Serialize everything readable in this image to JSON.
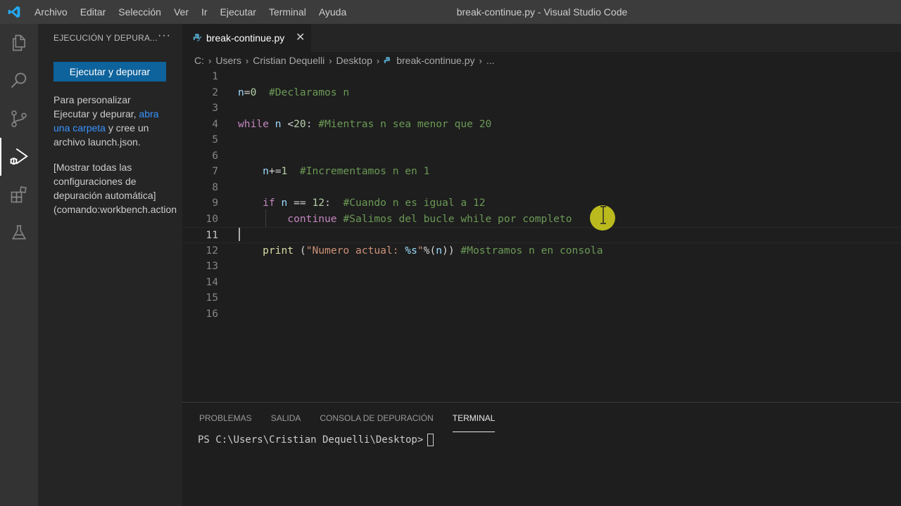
{
  "window": {
    "title": "break-continue.py - Visual Studio Code",
    "menu": [
      "Archivo",
      "Editar",
      "Selección",
      "Ver",
      "Ir",
      "Ejecutar",
      "Terminal",
      "Ayuda"
    ]
  },
  "activitybar": {
    "items": [
      "explorer-icon",
      "search-icon",
      "source-control-icon",
      "run-debug-icon",
      "extensions-icon",
      "testing-icon"
    ],
    "active": "run-debug-icon"
  },
  "sidebar": {
    "title": "EJECUCIÓN Y DEPURA...",
    "more": "···",
    "run_button": "Ejecutar y depurar",
    "para1_pre": "Para personalizar",
    "para1_line2": "Ejecutar y depurar,",
    "para1_link1": "abra",
    "para1_link2": "una carpeta",
    "para1_post": "y cree un",
    "para1_line4": "archivo launch.json.",
    "para2_line1": "[Mostrar todas las",
    "para2_line2": "configuraciones de",
    "para2_line3": "depuración automática]",
    "para2_line4": "(comando:workbench.action"
  },
  "tab": {
    "label": "break-continue.py",
    "close": "✕"
  },
  "breadcrumb": {
    "items": [
      "C:",
      "Users",
      "Cristian Dequelli",
      "Desktop"
    ],
    "file": "break-continue.py",
    "ellipsis": "..."
  },
  "editor": {
    "line_numbers": [
      "1",
      "2",
      "3",
      "4",
      "5",
      "6",
      "7",
      "8",
      "9",
      "10",
      "11",
      "12",
      "13",
      "14",
      "15",
      "16"
    ],
    "current_line": "11",
    "code": {
      "l2_var": "n",
      "l2_op": "=",
      "l2_num": "0",
      "l2_comment": "#Declaramos n",
      "l4_kw": "while",
      "l4_var": "n",
      "l4_op": "<",
      "l4_num": "20",
      "l4_colon": ":",
      "l4_comment": "#Mientras n sea menor que 20",
      "l7_var": "n",
      "l7_op": "+=",
      "l7_num": "1",
      "l7_comment": "#Incrementamos n en 1",
      "l9_kw": "if",
      "l9_var": "n",
      "l9_op": "==",
      "l9_num": "12",
      "l9_colon": ":",
      "l9_comment": "#Cuando n es igual a 12",
      "l10_kw": "continue",
      "l10_comment": "#Salimos del bucle while por completo",
      "l12_fn": "print",
      "l12_paren": "(",
      "l12_str": "\"Numero actual: ",
      "l12_fmt": "%s",
      "l12_strend": "\"",
      "l12_op": "%(",
      "l12_var": "n",
      "l12_close": "))",
      "l12_comment": "#Mostramos n en consola"
    }
  },
  "panel": {
    "tabs": [
      "PROBLEMAS",
      "SALIDA",
      "CONSOLA DE DEPURACIÓN",
      "TERMINAL"
    ],
    "active_tab": "TERMINAL",
    "prompt": "PS C:\\Users\\Cristian Dequelli\\Desktop>"
  },
  "colors": {
    "accent": "#0e639c",
    "link": "#3794ff",
    "keyword": "#c586c0",
    "variable": "#9cdcfe",
    "number": "#b5cea8",
    "comment": "#6a9955",
    "function": "#dcdcaa",
    "string": "#ce9178"
  }
}
